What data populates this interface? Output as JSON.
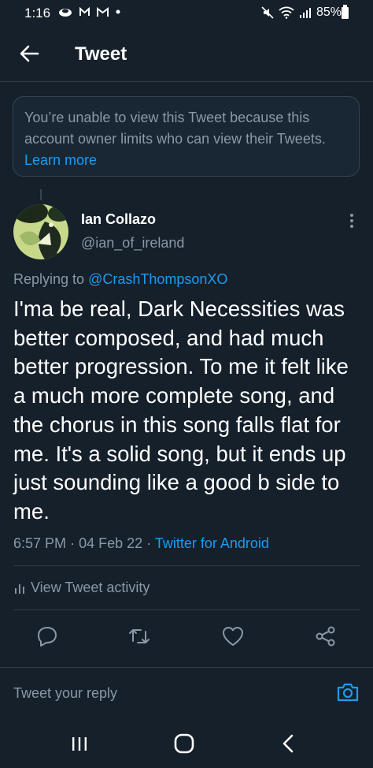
{
  "status_bar": {
    "time": "1:16",
    "left_icons": [
      "cloud-icon",
      "gmail-icon",
      "gmail-icon",
      "dot-icon"
    ],
    "battery_text": "85%"
  },
  "header": {
    "title": "Tweet"
  },
  "notice": {
    "text": "You’re unable to view this Tweet because this account owner limits who can view their Tweets.",
    "link_text": "Learn more"
  },
  "tweet": {
    "author_name": "Ian Collazo",
    "author_handle": "@ian_of_ireland",
    "replying_prefix": "Replying to",
    "replying_to": "@CrashThompsonXO",
    "text": "I'ma be real, Dark Necessities was better composed, and had much better progression. To me it felt like a much more complete song, and the chorus in this song falls flat for me. It's a solid song, but it ends up just sounding like a good b side to me.",
    "time": "6:57 PM",
    "sep1": "·",
    "date": "04 Feb 22",
    "sep2": "·",
    "source": "Twitter for Android",
    "activity_label": "View Tweet activity"
  },
  "actions": [
    "reply-icon",
    "retweet-icon",
    "like-icon",
    "share-icon"
  ],
  "reply_box": {
    "placeholder": "Tweet your reply"
  },
  "colors": {
    "background": "#15202b",
    "muted": "#8b98a5",
    "accent": "#1d9bf0",
    "divider": "#2f3b47"
  }
}
